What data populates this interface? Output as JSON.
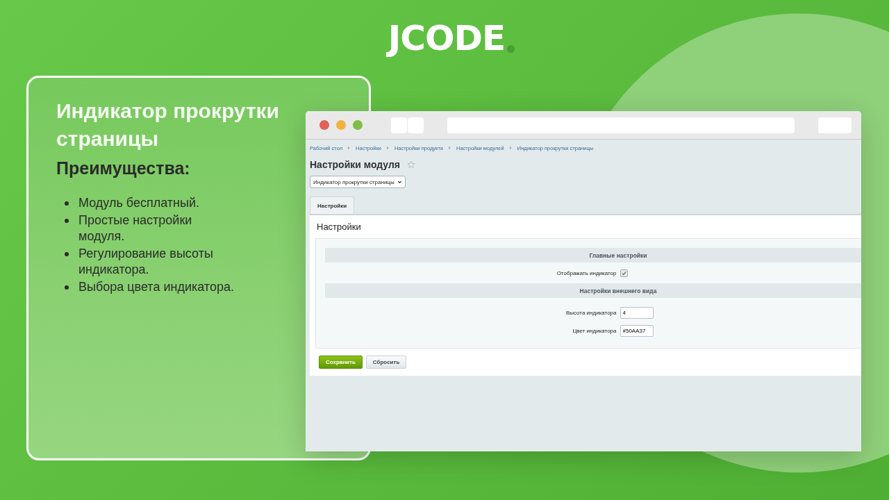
{
  "logo": {
    "text": "JCODE"
  },
  "card": {
    "title": "Индикатор прокрутки страницы",
    "subtitle": "Преимущества:",
    "bullets": [
      "Модуль бесплатный.",
      "Простые настройки модуля.",
      "Регулирование высоты индикатора.",
      "Выбора цвета индикатора."
    ]
  },
  "browser": {
    "breadcrumbs": [
      "Рабочий стол",
      "Настройки",
      "Настройки продукта",
      "Настройки модулей",
      "Индикатор прокрутки страницы"
    ],
    "page_title": "Настройки модуля",
    "module_select": {
      "value": "Индикатор прокрутки страницы"
    },
    "tabs": [
      {
        "label": "Настройки",
        "selected": true
      }
    ],
    "panel_title": "Настройки",
    "sections": [
      {
        "title": "Главные настройки",
        "fields": [
          {
            "kind": "checkbox",
            "label": "Отображать индикатор",
            "checked": true
          }
        ]
      },
      {
        "title": "Настройки внешнего вида",
        "fields": [
          {
            "kind": "text",
            "label": "Высота индикатора",
            "value": "4"
          },
          {
            "kind": "text",
            "label": "Цвет индикатора",
            "value": "#50AA37"
          }
        ]
      }
    ],
    "buttons": [
      {
        "label": "Сохранить",
        "kind": "primary"
      },
      {
        "label": "Сбросить",
        "kind": "secondary"
      }
    ]
  }
}
